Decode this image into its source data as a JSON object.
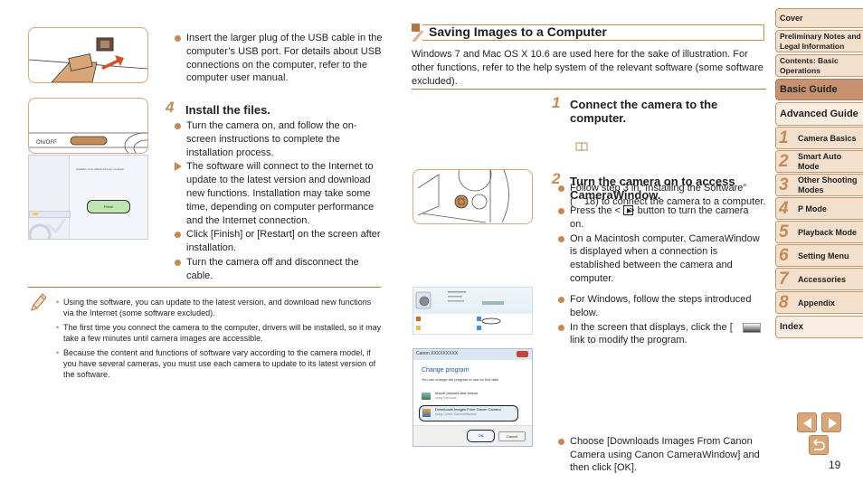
{
  "page_number": "19",
  "left": {
    "usb_bullet": "Insert the larger plug of the USB cable in the computer’s USB port. For details about USB connections on the computer, refer to the computer user manual.",
    "step4": {
      "number": "4",
      "title": "Install the files.",
      "items": [
        {
          "type": "bullet",
          "text": "Turn the camera on, and follow the on-screen instructions to complete the installation process."
        },
        {
          "type": "arrow",
          "text": "The software will connect to the Internet to update to the latest version and download new functions. Installation may take some time, depending on computer performance and the Internet connection."
        },
        {
          "type": "bullet",
          "text": "Click [Finish] or [Restart] on the screen after installation."
        },
        {
          "type": "bullet",
          "text": "Turn the camera off and disconnect the cable."
        }
      ]
    },
    "illustrations": {
      "onoff_label": "ON/OFF",
      "finish_button": "Finish",
      "install_message": "Installation of the software has been completed."
    },
    "notes": [
      "Using the software, you can update to the latest version, and download new functions via the Internet (some software excluded).",
      "The first time you connect the camera to the computer, drivers will be installed, so it may take a few minutes until camera images are accessible.",
      "Because the content and functions of software vary according to the camera model, if you have several cameras, you must use each camera to update to its latest version of the software."
    ]
  },
  "right": {
    "section_title": "Saving Images to a Computer",
    "intro": "Windows 7 and Mac OS X 10.6 are used here for the sake of illustration. For other functions, refer to the help system of the relevant software (some software excluded).",
    "step1": {
      "number": "1",
      "title": "Connect the camera to the computer.",
      "bullet": "Follow step 3 in “Installing the Software” (    18) to connect the camera to a computer."
    },
    "step2": {
      "number": "2",
      "title": "Turn the camera on to access CameraWindow.",
      "bullets": [
        "Press the <   > button to turn the camera on.",
        "On a Macintosh computer, CameraWindow is displayed when a connection is established between the camera and computer.",
        "For Windows, follow the steps introduced below.",
        "In the screen that displays, click the [     ] link to modify the program.",
        "Choose [Downloads Images From Canon Camera using Canon CameraWindow] and then click [OK]."
      ]
    },
    "dialog": {
      "title": "Canon XXXXXXXXX",
      "heading": "Change program",
      "subtitle": "You can change the program to use for this task.",
      "option1": "Import pictures and videos",
      "option1_sub": "using Windows",
      "option2": "Downloads Images From Canon Camera",
      "option2_sub": "using Canon CameraWindow",
      "ok": "OK",
      "cancel": "Cancel"
    }
  },
  "sidebar": {
    "cover": "Cover",
    "prelim": "Preliminary Notes and Legal Information",
    "contents": "Contents: Basic Operations",
    "basic": "Basic Guide",
    "advanced": "Advanced Guide",
    "chapters": [
      {
        "num": "1",
        "label": "Camera Basics"
      },
      {
        "num": "2",
        "label": "Smart Auto Mode"
      },
      {
        "num": "3",
        "label": "Other Shooting Modes"
      },
      {
        "num": "4",
        "label": "P Mode"
      },
      {
        "num": "5",
        "label": "Playback Mode"
      },
      {
        "num": "6",
        "label": "Setting Menu"
      },
      {
        "num": "7",
        "label": "Accessories"
      },
      {
        "num": "8",
        "label": "Appendix"
      }
    ],
    "index": "Index"
  },
  "colors": {
    "accent": "#c58a55",
    "sidebar_bg": "#f2dfcc",
    "sidebar_active": "#c69270"
  }
}
